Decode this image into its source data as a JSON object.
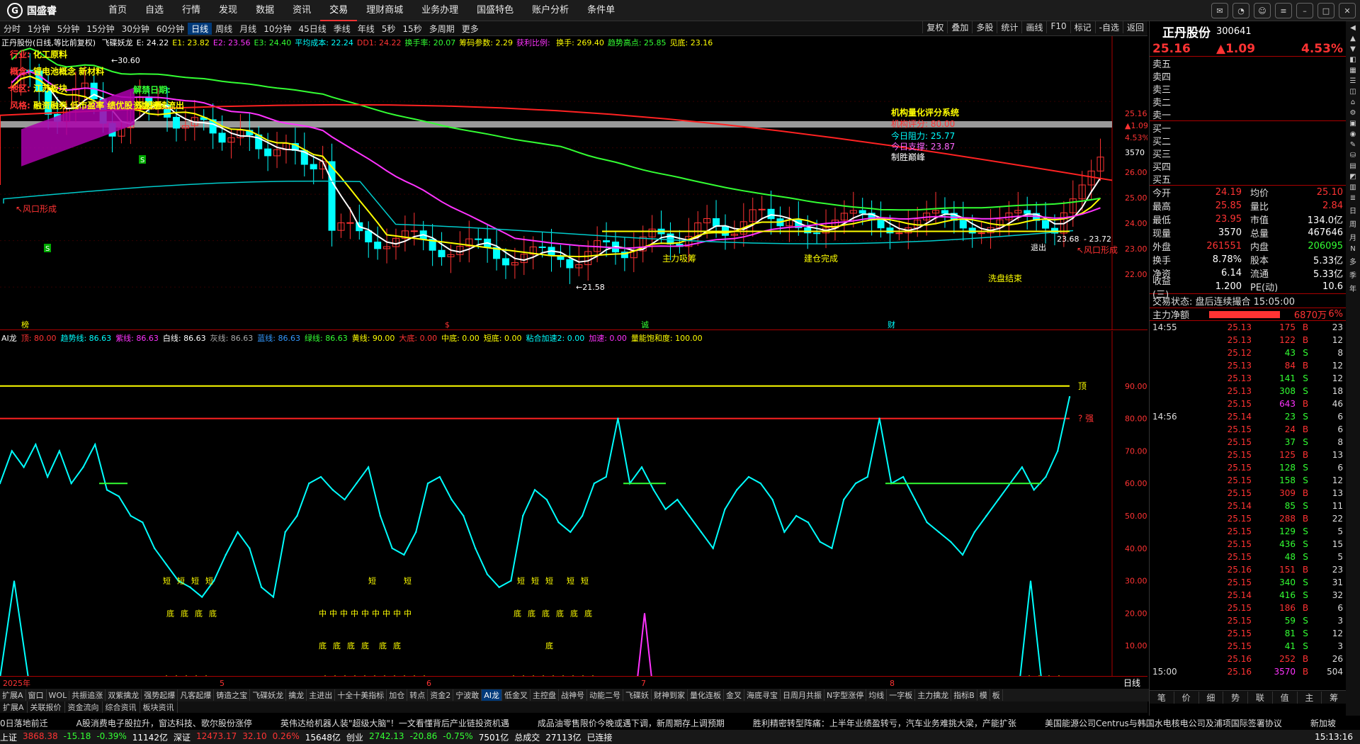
{
  "app": {
    "logo": "国盛睿"
  },
  "nav": [
    "首页",
    "自选",
    "行情",
    "发现",
    "数据",
    "资讯",
    "交易",
    "理财商城",
    "业务办理",
    "国盛特色",
    "账户分析",
    "条件单"
  ],
  "nav_active": 6,
  "periods": [
    "分时",
    "1分钟",
    "5分钟",
    "15分钟",
    "30分钟",
    "60分钟",
    "日线",
    "周线",
    "月线",
    "10分钟",
    "45日线",
    "季线",
    "年线",
    "5秒",
    "15秒",
    "多周期",
    "更多"
  ],
  "period_active": 6,
  "tools": [
    "复权",
    "叠加",
    "多股",
    "统计",
    "画线",
    "F10",
    "标记",
    "-自选",
    "返回"
  ],
  "main_legend": {
    "prefix": "正丹股份(日线,等比前复权)",
    "items": [
      {
        "t": "飞碟妖龙",
        "c": "#ffffff"
      },
      {
        "t": "E: 24.22",
        "c": "#ffffff"
      },
      {
        "t": "E1: 23.82",
        "c": "#ffff00"
      },
      {
        "t": "E2: 23.56",
        "c": "#ff33ff"
      },
      {
        "t": "E3: 24.40",
        "c": "#33ff33"
      },
      {
        "t": "平均成本: 22.24",
        "c": "#00ffff"
      },
      {
        "t": "DD1: 24.22",
        "c": "#ff3333"
      },
      {
        "t": "换手率: 20.07",
        "c": "#33ff33"
      },
      {
        "t": "筹码参数: 2.29",
        "c": "#ffff00"
      },
      {
        "t": "获利比例: ",
        "c": "#ff33ff"
      },
      {
        "t": "换手: 269.40",
        "c": "#ffff00"
      },
      {
        "t": "趋势高点: 25.85",
        "c": "#33ff33"
      },
      {
        "t": "见底: 23.16",
        "c": "#ffff00"
      }
    ]
  },
  "info": {
    "industry": "行业: 化工原料",
    "concept": "概念: 锂电池概念 新材料",
    "region": "地区: 江苏板块",
    "style": "风格: 融资融券 低市盈率 绩优股 深股通",
    "unlock": "解禁日期:",
    "fund": "资金持续流出",
    "risk": "风口形成",
    "risk2": "风口形成",
    "high_label": "30.60",
    "low_label": "21.58",
    "flag_s1": "S",
    "flag_s2": "S"
  },
  "inst": {
    "title": "机构量化评分系统",
    "score": "机构评分: 80.00",
    "resist": "今日阻力: 25.77",
    "support": "今日支撑: 23.87",
    "verdict": "制胜巅峰"
  },
  "annotations": {
    "zl": "主力吸筹",
    "jc": "建仓完成",
    "xp": "洗盘结束",
    "tc": "退出",
    "p1": "23.68",
    "p2": "23.72"
  },
  "main_axis": [
    {
      "v": "25.16",
      "c": "#ff3333"
    },
    {
      "v": "▲1.09",
      "c": "#ff3333"
    },
    {
      "v": "4.53%",
      "c": "#ff3333"
    },
    {
      "v": "3570",
      "c": "#ffffff"
    },
    {
      "v": "26.00",
      "c": "#ff3333"
    },
    {
      "v": "25.00",
      "c": "#ff3333"
    },
    {
      "v": "24.00",
      "c": "#ff3333"
    },
    {
      "v": "23.00",
      "c": "#ff3333"
    },
    {
      "v": "22.00",
      "c": "#ff3333"
    }
  ],
  "markers": [
    "榜",
    "$",
    "诚",
    "财"
  ],
  "ai_legend": {
    "items": [
      {
        "t": "AI龙",
        "c": "#ffffff"
      },
      {
        "t": "顶: 80.00",
        "c": "#ff3333"
      },
      {
        "t": "趋势线: 86.63",
        "c": "#00ffff"
      },
      {
        "t": "紫线: 86.63",
        "c": "#ff33ff"
      },
      {
        "t": "白线: 86.63",
        "c": "#ffffff"
      },
      {
        "t": "灰线: 86.63",
        "c": "#aaaaaa"
      },
      {
        "t": "蓝线: 86.63",
        "c": "#3399ff"
      },
      {
        "t": "绿线: 86.63",
        "c": "#33ff33"
      },
      {
        "t": "黄线: 90.00",
        "c": "#ffff00"
      },
      {
        "t": "大底: 0.00",
        "c": "#ff3333"
      },
      {
        "t": "中底: 0.00",
        "c": "#ffff00"
      },
      {
        "t": "短底: 0.00",
        "c": "#ffff00"
      },
      {
        "t": "粘合加速2: 0.00",
        "c": "#00ffff"
      },
      {
        "t": "加速: 0.00",
        "c": "#ff33ff"
      },
      {
        "t": "量能饱和度: 100.00",
        "c": "#ffff00"
      }
    ]
  },
  "ai_axis": [
    "90.00",
    "80.00",
    "70.00",
    "60.00",
    "50.00",
    "40.00",
    "30.00",
    "20.00",
    "10.00"
  ],
  "ai_labels": {
    "top": "顶",
    "strong": "强",
    "short": "短",
    "bottom": "底",
    "mid": "中"
  },
  "xaxis": {
    "labels": [
      "2025年",
      "5",
      "6",
      "7",
      "8"
    ],
    "right": "日线"
  },
  "chart_data": {
    "type": "line",
    "ylim": [
      0,
      100
    ],
    "series": [
      {
        "name": "趋势线",
        "values": [
          60,
          70,
          65,
          72,
          62,
          70,
          60,
          65,
          72,
          58,
          56,
          50,
          48,
          40,
          35,
          30,
          28,
          25,
          30,
          38,
          45,
          40,
          28,
          25,
          45,
          50,
          60,
          62,
          58,
          55,
          60,
          65,
          50,
          40,
          38,
          45,
          60,
          62,
          55,
          50,
          40,
          32,
          28,
          30,
          50,
          58,
          55,
          48,
          45,
          50,
          60,
          62,
          80,
          60,
          65,
          58,
          52,
          55,
          50,
          45,
          40,
          52,
          58,
          62,
          60,
          55,
          45,
          50,
          48,
          42,
          40,
          55,
          60,
          62,
          80,
          60,
          62,
          55,
          48,
          45,
          42,
          38,
          45,
          50,
          55,
          60,
          65,
          58,
          62,
          70,
          86.63
        ]
      }
    ]
  },
  "tabs": [
    "扩展A",
    "窗口",
    "WOL",
    "共振追涨",
    "双紫擒龙",
    "强势起爆",
    "凡客起爆",
    "铸造之宝",
    "飞碟妖龙",
    "擒龙",
    "主进出",
    "十全十美指标",
    "加仓",
    "转点",
    "资金2",
    "宁波敢",
    "AI龙",
    "低金叉",
    "主控盘",
    "战神号",
    "动能二号",
    "飞碟妖",
    "财神到家",
    "量化连板",
    "金叉",
    "海底寻宝",
    "日周月共振",
    "N字型涨停",
    "均线",
    "一字板",
    "主力擒龙",
    "指标B",
    "模",
    "板"
  ],
  "tab_active": 16,
  "tabs2": [
    "扩展A",
    "关联报价",
    "资金流向",
    "综合资讯",
    "板块资讯"
  ],
  "news": [
    "0日落地前迁",
    "A股消费电子股拉升，窗达科技、歌尔股份涨停",
    "英伟达给机器人装\"超级大脑\"！一文看懂背后产业链投资机遇",
    "成品油零售限价今晚或遇下调，新周期存上调预期",
    "胜利精密转型阵痛：上半年业绩盈转亏，汽车业务难挑大梁，产能扩张",
    "美国能源公司Centrus与韩国水电核电公司及浦项国际签署协议",
    "新加坡"
  ],
  "status": [
    {
      "t": "上证",
      "c": "#ffffff"
    },
    {
      "t": "3868.38",
      "c": "#ff3333"
    },
    {
      "t": "-15.18",
      "c": "#33ff33"
    },
    {
      "t": "-0.39%",
      "c": "#33ff33"
    },
    {
      "t": "11142亿",
      "c": "#ffffff"
    },
    {
      "t": "深证",
      "c": "#ffffff"
    },
    {
      "t": "12473.17",
      "c": "#ff3333"
    },
    {
      "t": "32.10",
      "c": "#ff3333"
    },
    {
      "t": "0.26%",
      "c": "#ff3333"
    },
    {
      "t": "15648亿",
      "c": "#ffffff"
    },
    {
      "t": "创业",
      "c": "#ffffff"
    },
    {
      "t": "2742.13",
      "c": "#33ff33"
    },
    {
      "t": "-20.86",
      "c": "#33ff33"
    },
    {
      "t": "-0.75%",
      "c": "#33ff33"
    },
    {
      "t": "7501亿",
      "c": "#ffffff"
    },
    {
      "t": "总成交",
      "c": "#ffffff"
    },
    {
      "t": "27113亿",
      "c": "#ffffff"
    },
    {
      "t": "已连接",
      "c": "#ffffff"
    }
  ],
  "clock": "15:13:16",
  "quote": {
    "name": "正丹股份",
    "code": "300641",
    "price": "25.16",
    "change": "▲1.09",
    "pct": "4.53%",
    "book": [
      "卖五",
      "卖四",
      "卖三",
      "卖二",
      "卖一",
      "买一",
      "买二",
      "买三",
      "买四",
      "买五"
    ],
    "stats": [
      [
        "今开",
        "24.19",
        "均价",
        "25.10"
      ],
      [
        "最高",
        "25.85",
        "量比",
        "2.84"
      ],
      [
        "最低",
        "23.95",
        "市值",
        "134.0亿"
      ],
      [
        "现量",
        "3570",
        "总量",
        "467646"
      ],
      [
        "外盘",
        "261551",
        "内盘",
        "206095"
      ],
      [
        "换手",
        "8.78%",
        "股本",
        "5.33亿"
      ],
      [
        "净资",
        "6.14",
        "流通",
        "5.33亿"
      ],
      [
        "收益(三)",
        "1.200",
        "PE(动)",
        "10.6"
      ]
    ],
    "trade_status": "交易状态: 盘后连续撮合 15:05:00",
    "main_flow_label": "主力净额",
    "main_flow": "6870万",
    "main_flow_pct": "6%"
  },
  "ticks": [
    [
      "14:55",
      "25.13",
      "175",
      "B",
      "23"
    ],
    [
      "",
      "25.13",
      "122",
      "B",
      "12"
    ],
    [
      "",
      "25.12",
      "43",
      "S",
      "8"
    ],
    [
      "",
      "25.13",
      "84",
      "B",
      "12"
    ],
    [
      "",
      "25.13",
      "141",
      "S",
      "12"
    ],
    [
      "",
      "25.13",
      "308",
      "S",
      "18"
    ],
    [
      "",
      "25.15",
      "643",
      "B",
      "46"
    ],
    [
      "14:56",
      "25.14",
      "23",
      "S",
      "6"
    ],
    [
      "",
      "25.15",
      "24",
      "B",
      "6"
    ],
    [
      "",
      "25.15",
      "37",
      "S",
      "8"
    ],
    [
      "",
      "25.15",
      "125",
      "B",
      "13"
    ],
    [
      "",
      "25.15",
      "128",
      "S",
      "6"
    ],
    [
      "",
      "25.15",
      "158",
      "S",
      "12"
    ],
    [
      "",
      "25.15",
      "309",
      "B",
      "13"
    ],
    [
      "",
      "25.14",
      "85",
      "S",
      "11"
    ],
    [
      "",
      "25.15",
      "288",
      "B",
      "22"
    ],
    [
      "",
      "25.15",
      "129",
      "S",
      "5"
    ],
    [
      "",
      "25.15",
      "436",
      "S",
      "15"
    ],
    [
      "",
      "25.15",
      "48",
      "S",
      "5"
    ],
    [
      "",
      "25.16",
      "151",
      "B",
      "23"
    ],
    [
      "",
      "25.15",
      "340",
      "S",
      "31"
    ],
    [
      "",
      "25.14",
      "416",
      "S",
      "32"
    ],
    [
      "",
      "25.15",
      "186",
      "B",
      "6"
    ],
    [
      "",
      "25.15",
      "59",
      "S",
      "3"
    ],
    [
      "",
      "25.15",
      "81",
      "S",
      "12"
    ],
    [
      "",
      "25.15",
      "41",
      "S",
      "3"
    ],
    [
      "",
      "25.16",
      "252",
      "B",
      "26"
    ],
    [
      "15:00",
      "25.16",
      "3570",
      "B",
      "504"
    ]
  ],
  "rp_tabs": [
    "笔",
    "价",
    "细",
    "势",
    "联",
    "值",
    "主",
    "筹"
  ],
  "side_icons": [
    "日",
    "周",
    "月",
    "N",
    "多",
    "季",
    "年"
  ]
}
